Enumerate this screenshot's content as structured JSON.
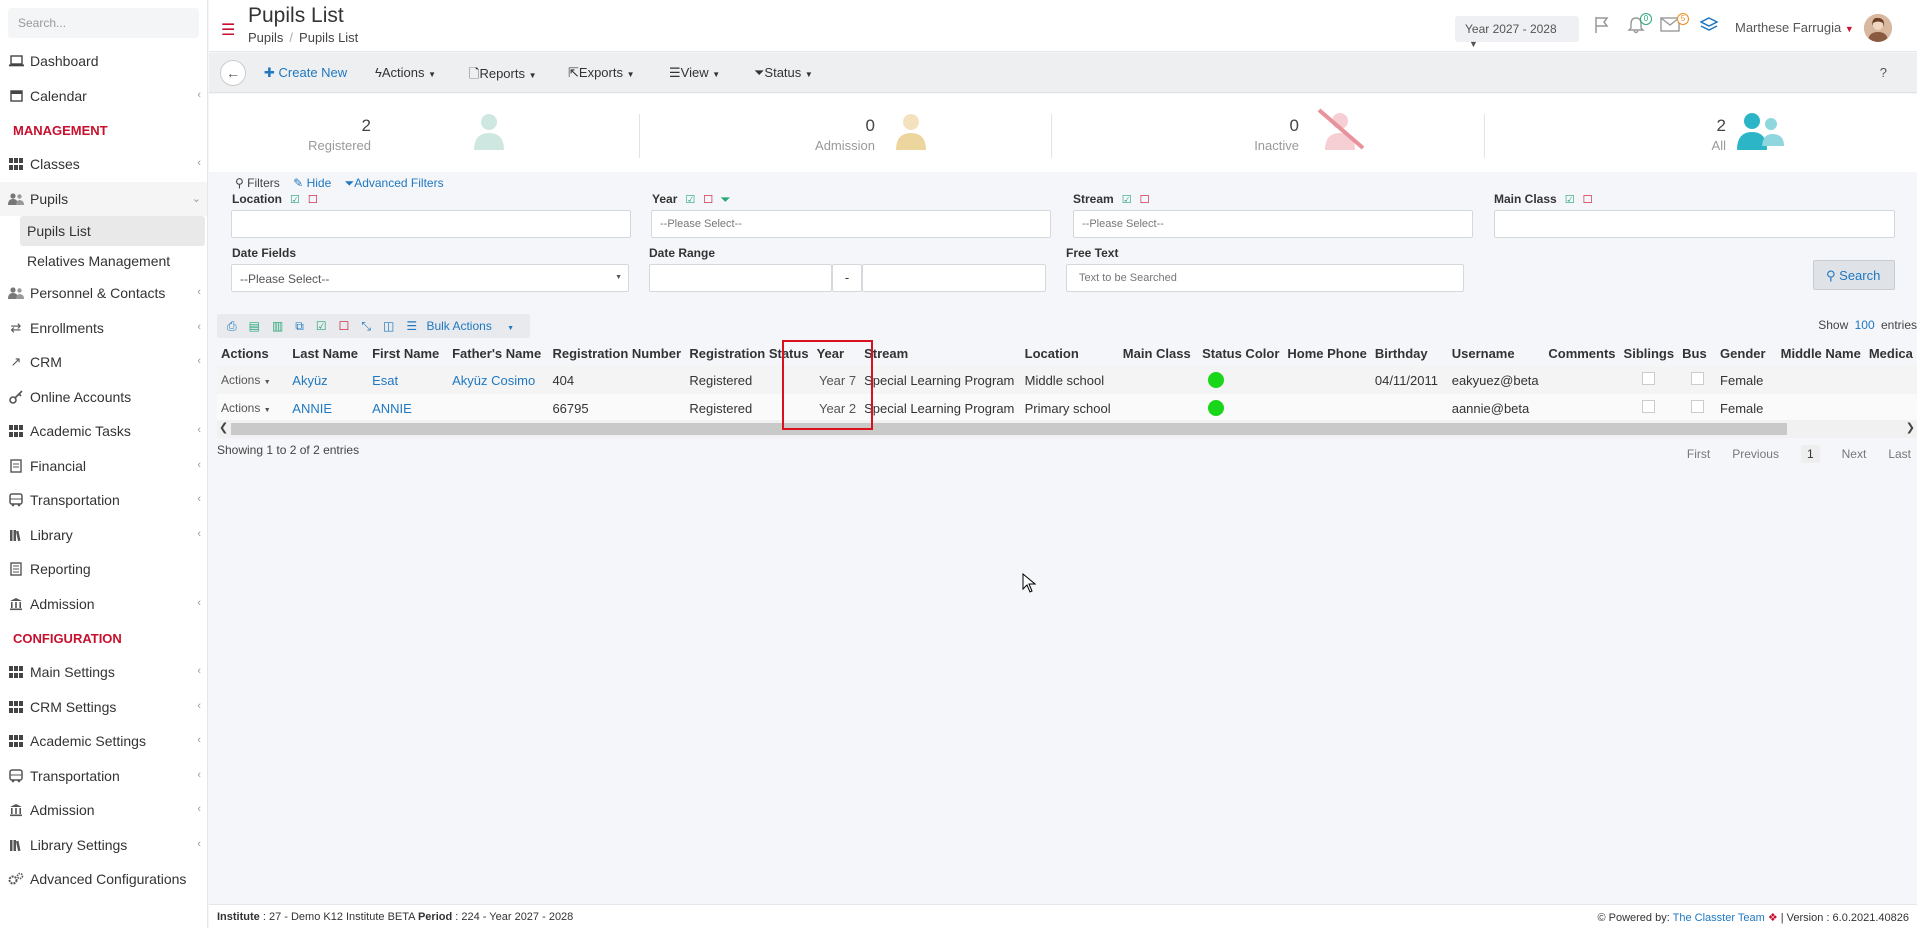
{
  "sidebar": {
    "search_placeholder": "Search...",
    "items": [
      {
        "label": "Dashboard",
        "icon": "laptop-icon"
      },
      {
        "label": "Calendar",
        "icon": "calendar-icon"
      }
    ],
    "management_label": "MANAGEMENT",
    "management_items": [
      {
        "label": "Classes"
      },
      {
        "label": "Pupils"
      }
    ],
    "pupils_sub": [
      {
        "label": "Pupils List"
      },
      {
        "label": "Relatives Management"
      }
    ],
    "management_items2": [
      {
        "label": "Personnel & Contacts"
      },
      {
        "label": "Enrollments"
      },
      {
        "label": "CRM"
      },
      {
        "label": "Online Accounts"
      },
      {
        "label": "Academic Tasks"
      },
      {
        "label": "Financial"
      },
      {
        "label": "Transportation"
      },
      {
        "label": "Library"
      },
      {
        "label": "Reporting"
      },
      {
        "label": "Admission"
      }
    ],
    "configuration_label": "CONFIGURATION",
    "configuration_items": [
      {
        "label": "Main Settings"
      },
      {
        "label": "CRM Settings"
      },
      {
        "label": "Academic Settings"
      },
      {
        "label": "Transportation"
      },
      {
        "label": "Admission"
      },
      {
        "label": "Library Settings"
      },
      {
        "label": "Advanced Configurations"
      }
    ]
  },
  "header": {
    "title": "Pupils List",
    "breadcrumb": [
      "Pupils",
      "Pupils List"
    ],
    "year_select": "Year 2027 - 2028",
    "notifications_count": "0",
    "messages_count": "5",
    "user_name": "Marthese Farrugia"
  },
  "toolbar": {
    "create_new": "Create New",
    "actions": "Actions",
    "reports": "Reports",
    "exports": "Exports",
    "view": "View",
    "status": "Status",
    "help": "?"
  },
  "stats": [
    {
      "value": "2",
      "label": "Registered"
    },
    {
      "value": "0",
      "label": "Admission"
    },
    {
      "value": "0",
      "label": "Inactive"
    },
    {
      "value": "2",
      "label": "All"
    }
  ],
  "filters": {
    "title": "Filters",
    "hide": "Hide",
    "advanced": "Advanced Filters",
    "location_label": "Location",
    "year_label": "Year",
    "stream_label": "Stream",
    "main_class_label": "Main Class",
    "date_fields_label": "Date Fields",
    "date_range_label": "Date Range",
    "free_text_label": "Free Text",
    "please_select": "--Please Select--",
    "free_text_placeholder": "Text to be Searched",
    "date_sep": "-",
    "search_button": "Search"
  },
  "table": {
    "bulk_actions": "Bulk Actions",
    "show_label": "Show",
    "show_count": "100",
    "entries_label": "entries",
    "columns": [
      "Actions",
      "Last Name",
      "First Name",
      "Father's Name",
      "Registration Number",
      "Registration Status",
      "Year",
      "Stream",
      "Location",
      "Main Class",
      "Status Color",
      "Home Phone",
      "Birthday",
      "Username",
      "Comments",
      "Siblings",
      "Bus",
      "Gender",
      "Middle Name",
      "Medica"
    ],
    "rows": [
      {
        "actions": "Actions",
        "last_name": "Akyüz",
        "first_name": "Esat",
        "father_name": "Akyüz Cosimo",
        "reg_number": "404",
        "reg_status": "Registered",
        "year": "Year 7",
        "stream": "Special Learning Program",
        "location": "Middle school",
        "birthday": "04/11/2011",
        "username": "eakyuez@beta",
        "gender": "Female"
      },
      {
        "actions": "Actions",
        "last_name": "ANNIE",
        "first_name": "ANNIE",
        "father_name": "",
        "reg_number": "66795",
        "reg_status": "Registered",
        "year": "Year 2",
        "stream": "Special Learning Program",
        "location": "Primary school",
        "birthday": "",
        "username": "aannie@beta",
        "gender": "Female"
      }
    ],
    "showing": "Showing 1 to 2 of 2 entries",
    "pager": {
      "first": "First",
      "previous": "Previous",
      "current": "1",
      "next": "Next",
      "last": "Last"
    }
  },
  "footer": {
    "institute_label": "Institute",
    "institute_value": ": 27 - Demo K12 Institute BETA",
    "period_label": "Period",
    "period_value": ": 224 - Year 2027 - 2028",
    "powered_by": "Powered by:",
    "team": "The Classter Team",
    "version": "| Version : 6.0.2021.40826"
  },
  "colors": {
    "accent": "#1f78c1",
    "brand": "#c8102e",
    "status_green": "#1ad61a"
  }
}
